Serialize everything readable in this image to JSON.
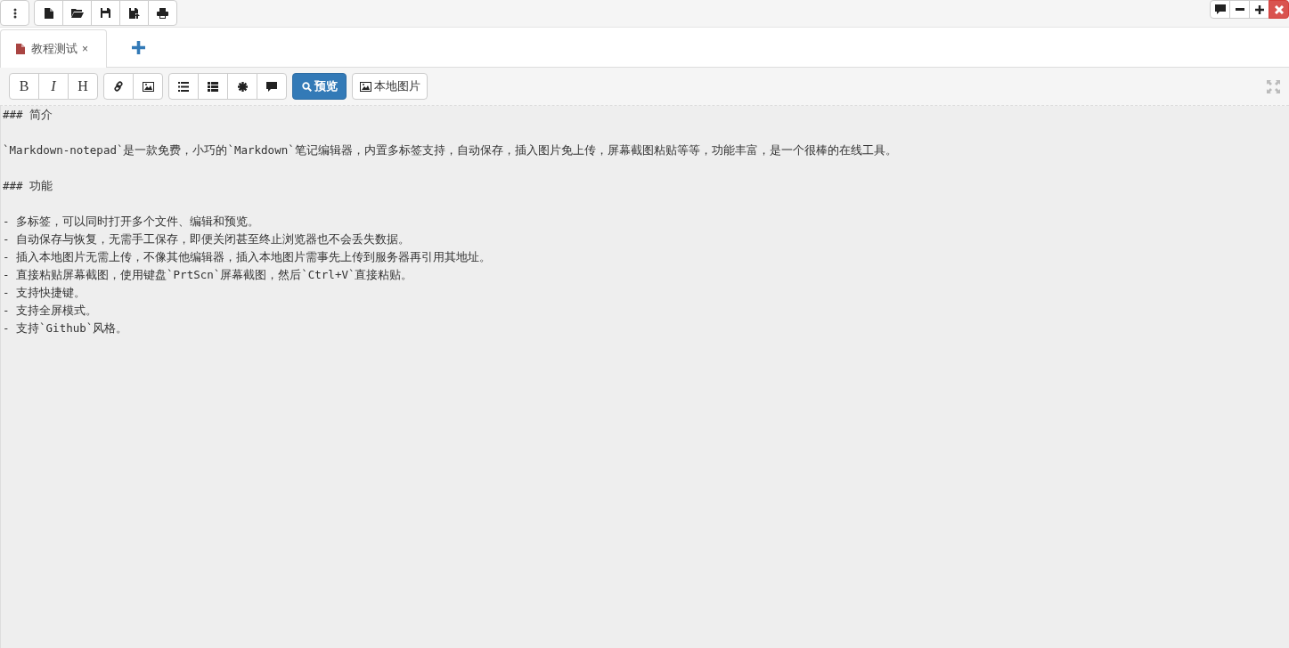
{
  "tabs": [
    {
      "label": "教程测试",
      "close": "×",
      "selected": true
    }
  ],
  "format_buttons": [
    "B",
    "I",
    "H"
  ],
  "preview_button": "预览",
  "local_image_button": "本地图片",
  "editor": {
    "blocks": [
      [
        "### 简介"
      ],
      [
        "`Markdown-notepad`是一款免费，小巧的`Markdown`笔记编辑器，内置多标签支持，自动保存，插入图片免上传，屏幕截图粘贴等等，功能丰富，是一个很棒的在线工具。"
      ],
      [
        "### 功能"
      ],
      [
        "- 多标签，可以同时打开多个文件、编辑和预览。",
        "- 自动保存与恢复，无需手工保存，即便关闭甚至终止浏览器也不会丢失数据。",
        "- 插入本地图片无需上传，不像其他编辑器，插入本地图片需事先上传到服务器再引用其地址。",
        "- 直接粘贴屏幕截图，使用键盘`PrtScn`屏幕截图，然后`Ctrl+V`直接粘贴。",
        "- 支持快捷键。",
        "- 支持全屏模式。",
        "- 支持`Github`风格。"
      ]
    ]
  }
}
